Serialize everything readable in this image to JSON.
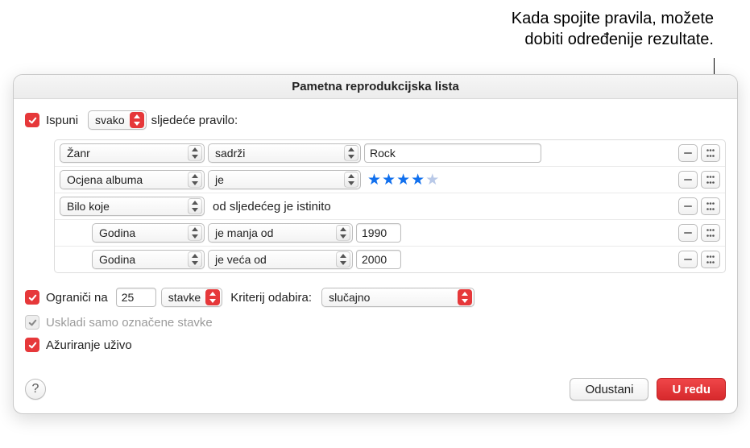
{
  "annotation": {
    "line1": "Kada spojite pravila, možete",
    "line2": "dobiti određenije rezultate."
  },
  "dialog": {
    "title": "Pametna reprodukcijska lista",
    "match": {
      "prefix": "Ispuni",
      "condition": "svako",
      "suffix": "sljedeće pravilo:"
    },
    "rules": [
      {
        "indent": 0,
        "field": "Žanr",
        "fieldWidth": 180,
        "op": "sadrži",
        "opWidth": 190,
        "valueType": "text",
        "value": "Rock"
      },
      {
        "indent": 0,
        "field": "Ocjena albuma",
        "fieldWidth": 180,
        "op": "je",
        "opWidth": 190,
        "valueType": "stars",
        "stars": 4,
        "starsMax": 5
      },
      {
        "indent": 0,
        "field": "Bilo koje",
        "fieldWidth": 180,
        "valueType": "label",
        "label": "od sljedećeg je istinito"
      },
      {
        "indent": 1,
        "field": "Godina",
        "fieldWidth": 140,
        "op": "je manja od",
        "opWidth": 180,
        "valueType": "number",
        "value": "1990"
      },
      {
        "indent": 1,
        "field": "Godina",
        "fieldWidth": 140,
        "op": "je veća od",
        "opWidth": 180,
        "valueType": "number",
        "value": "2000"
      }
    ],
    "limit": {
      "checked": true,
      "label": "Ograniči na",
      "value": "25",
      "unit": "stavke",
      "criteriaLabel": "Kriterij odabira:",
      "criteria": "slučajno"
    },
    "sync": {
      "checked": true,
      "disabled": true,
      "label": "Uskladi samo označene stavke"
    },
    "live": {
      "checked": true,
      "label": "Ažuriranje uživo"
    },
    "footer": {
      "cancel": "Odustani",
      "ok": "U redu"
    }
  }
}
